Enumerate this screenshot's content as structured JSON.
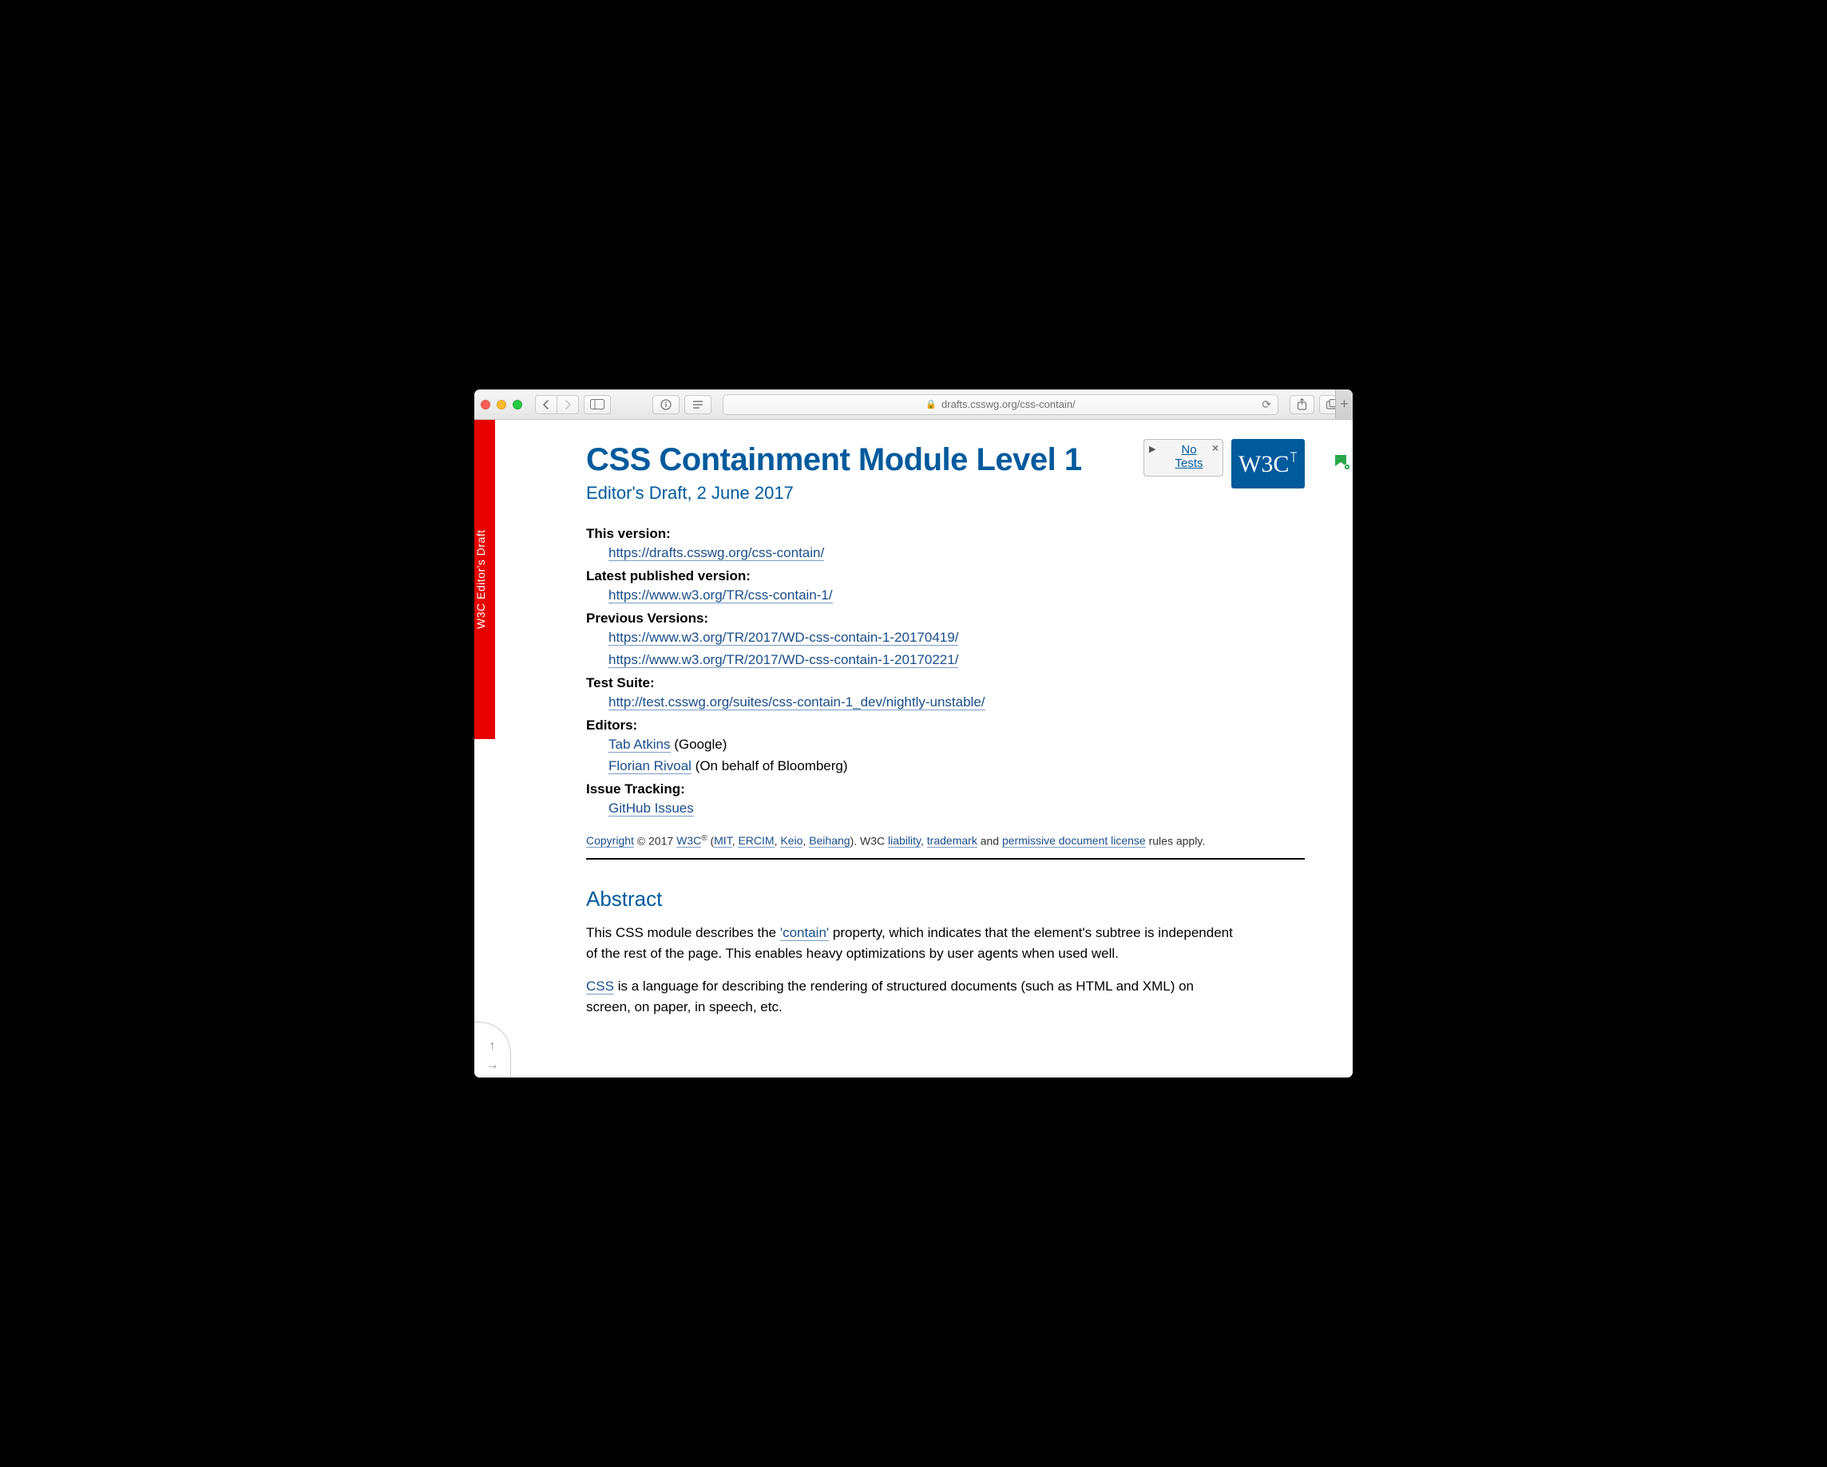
{
  "browser": {
    "url_display": "drafts.csswg.org/css-contain/"
  },
  "ribbon": "W3C Editor's Draft",
  "header": {
    "title": "CSS Containment Module Level 1",
    "subtitle": "Editor's Draft, 2 June 2017"
  },
  "tests_widget": {
    "line1": "No",
    "line2": "Tests"
  },
  "w3c_logo_text": "W3C",
  "meta": {
    "this_version_label": "This version:",
    "this_version_url": "https://drafts.csswg.org/css-contain/",
    "latest_label": "Latest published version:",
    "latest_url": "https://www.w3.org/TR/css-contain-1/",
    "prev_label": "Previous Versions:",
    "prev_urls": [
      "https://www.w3.org/TR/2017/WD-css-contain-1-20170419/",
      "https://www.w3.org/TR/2017/WD-css-contain-1-20170221/"
    ],
    "testsuite_label": "Test Suite:",
    "testsuite_url": "http://test.csswg.org/suites/css-contain-1_dev/nightly-unstable/",
    "editors_label": "Editors:",
    "editors": [
      {
        "name": "Tab Atkins",
        "affil": " (Google)"
      },
      {
        "name": "Florian Rivoal",
        "affil": " (On behalf of Bloomberg)"
      }
    ],
    "issues_label": "Issue Tracking:",
    "issues_link": "GitHub Issues"
  },
  "copyright": {
    "cr": "Copyright",
    "year": " © 2017 ",
    "w3c": "W3C",
    "sup": "®",
    "open": " (",
    "mit": "MIT",
    "c1": ", ",
    "ercim": "ERCIM",
    "c2": ", ",
    "keio": "Keio",
    "c3": ", ",
    "beihang": "Beihang",
    "close": "). W3C ",
    "liability": "liability",
    "c4": ", ",
    "trademark": "trademark",
    "and": " and ",
    "license": "permissive document license",
    "tail": " rules apply."
  },
  "abstract": {
    "heading": "Abstract",
    "p1_a": "This CSS module describes the ",
    "p1_link": "'contain'",
    "p1_b": " property, which indicates that the element's subtree is independent of the rest of the page. This enables heavy optimizations by user agents when used well.",
    "p2_link": "CSS",
    "p2_b": " is a language for describing the rendering of structured documents (such as HTML and XML) on screen, on paper, in speech, etc."
  }
}
